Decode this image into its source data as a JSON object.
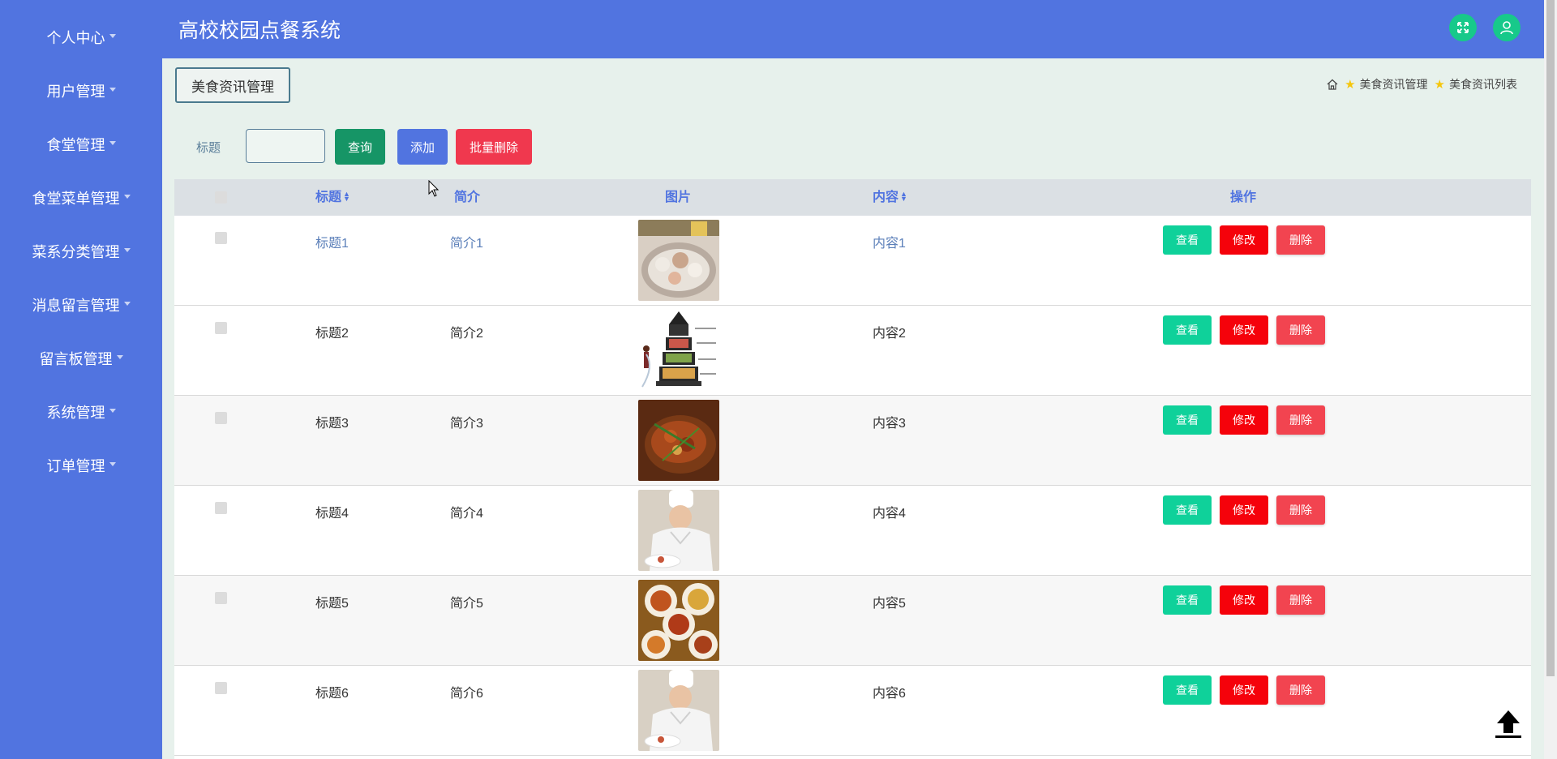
{
  "app": {
    "title": "高校校园点餐系统"
  },
  "sidebar": {
    "items": [
      {
        "label": "个人中心"
      },
      {
        "label": "用户管理"
      },
      {
        "label": "食堂管理"
      },
      {
        "label": "食堂菜单管理"
      },
      {
        "label": "菜系分类管理"
      },
      {
        "label": "消息留言管理"
      },
      {
        "label": "留言板管理"
      },
      {
        "label": "系统管理"
      },
      {
        "label": "订单管理"
      }
    ]
  },
  "header": {
    "section_tag": "美食资讯管理",
    "breadcrumb": [
      "美食资讯管理",
      "美食资讯列表"
    ]
  },
  "search": {
    "label": "标题",
    "value": "",
    "placeholder": "",
    "query_label": "查询",
    "add_label": "添加",
    "batch_delete_label": "批量删除"
  },
  "table": {
    "columns": [
      "标题",
      "简介",
      "图片",
      "内容",
      "操作"
    ],
    "rows": [
      {
        "title": "标题1",
        "intro": "简介1",
        "content": "内容1",
        "image": "seafood-platter"
      },
      {
        "title": "标题2",
        "intro": "简介2",
        "content": "内容2",
        "image": "food-pyramid"
      },
      {
        "title": "标题3",
        "intro": "简介3",
        "content": "内容3",
        "image": "spicy-stew"
      },
      {
        "title": "标题4",
        "intro": "简介4",
        "content": "内容4",
        "image": "chef-plating"
      },
      {
        "title": "标题5",
        "intro": "简介5",
        "content": "内容5",
        "image": "dishes-on-table"
      },
      {
        "title": "标题6",
        "intro": "简介6",
        "content": "内容6",
        "image": "chef-plating"
      }
    ],
    "actions": {
      "view": "查看",
      "edit": "修改",
      "delete": "删除"
    }
  },
  "colors": {
    "primary": "#5174e0",
    "success": "#0fd19a",
    "danger": "#f5020b",
    "query": "#169566"
  }
}
